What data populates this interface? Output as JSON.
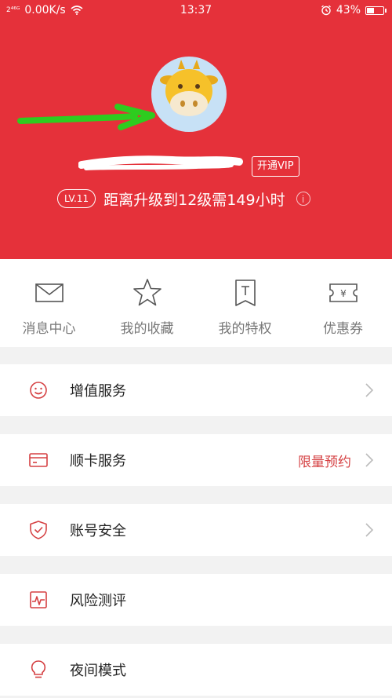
{
  "status_bar": {
    "signal": "2⁴⁶ᴳ",
    "net_speed": "0.00K/s",
    "time": "13:37",
    "battery": "43%",
    "battery_level": 0.43
  },
  "profile": {
    "vip_button": "开通VIP",
    "level_badge": "LV.11",
    "level_text": "距离升级到12级需149小时",
    "info_icon": "i"
  },
  "shortcuts": [
    {
      "label": "消息中心",
      "icon": "mail-icon"
    },
    {
      "label": "我的收藏",
      "icon": "star-icon"
    },
    {
      "label": "我的特权",
      "icon": "privilege-icon"
    },
    {
      "label": "优惠券",
      "icon": "coupon-icon"
    }
  ],
  "menu": [
    {
      "label": "增值服务",
      "icon": "smile-icon",
      "extra": ""
    },
    {
      "label": "顺卡服务",
      "icon": "card-icon",
      "extra": "限量预约"
    },
    {
      "label": "账号安全",
      "icon": "shield-icon",
      "extra": ""
    },
    {
      "label": "风险测评",
      "icon": "chart-icon",
      "extra": ""
    },
    {
      "label": "夜间模式",
      "icon": "bulb-icon",
      "extra": ""
    }
  ],
  "colors": {
    "brand_red": "#e5313a",
    "icon_red": "#d54143",
    "background": "#f2f2f2"
  }
}
